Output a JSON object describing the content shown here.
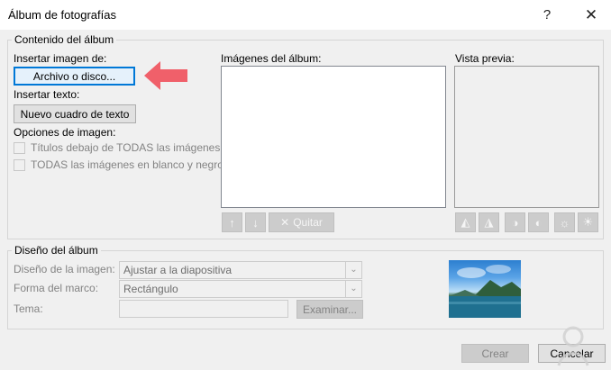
{
  "window": {
    "title": "Álbum de fotografías"
  },
  "content_group": {
    "legend": "Contenido del álbum",
    "insert_image_label": "Insertar imagen de:",
    "file_or_disk_button": "Archivo o disco...",
    "insert_text_label": "Insertar texto:",
    "new_textbox_button": "Nuevo cuadro de texto",
    "image_options_label": "Opciones de imagen:",
    "captions_checkbox": "Títulos debajo de TODAS las imágenes",
    "bw_checkbox": "TODAS las imágenes en blanco y negro",
    "album_images_label": "Imágenes del álbum:",
    "remove_button": "Quitar",
    "preview_label": "Vista previa:"
  },
  "layout_group": {
    "legend": "Diseño del álbum",
    "picture_layout_label": "Diseño de la imagen:",
    "picture_layout_value": "Ajustar a la diapositiva",
    "frame_shape_label": "Forma del marco:",
    "frame_shape_value": "Rectángulo",
    "theme_label": "Tema:",
    "browse_button": "Examinar..."
  },
  "footer": {
    "create_button": "Crear",
    "cancel_button": "Cancelar"
  },
  "colors": {
    "accent": "#0078d7",
    "arrow": "#f0606a"
  }
}
